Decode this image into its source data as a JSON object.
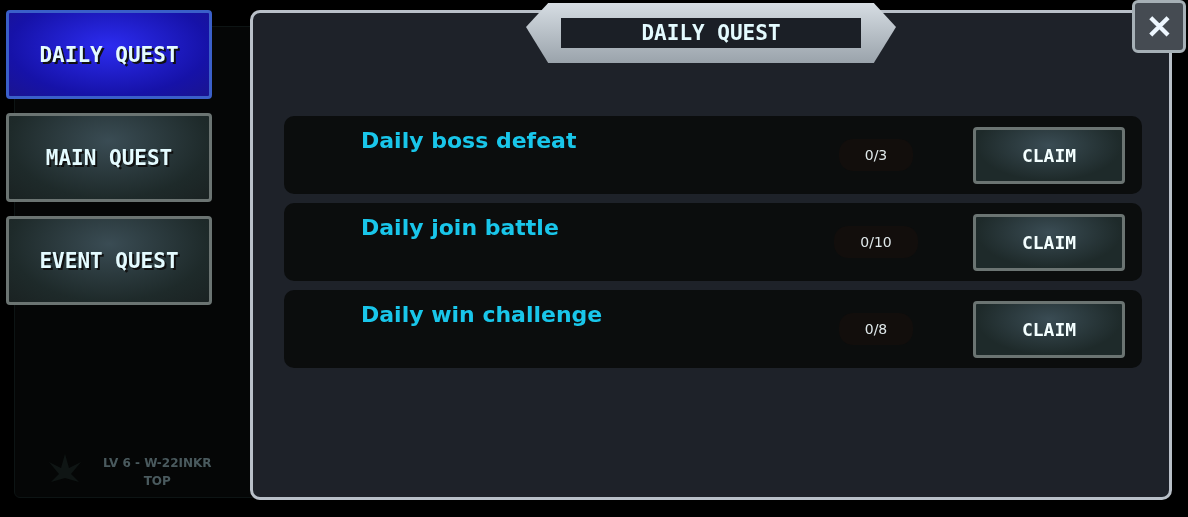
{
  "background": {
    "line_1": "LV 6 - W-22INKR",
    "line_2": "TOP"
  },
  "tabs": [
    {
      "label": "DAILY QUEST",
      "selected": true
    },
    {
      "label": "MAIN QUEST",
      "selected": false
    },
    {
      "label": "EVENT QUEST",
      "selected": false
    }
  ],
  "panel": {
    "title": "DAILY QUEST",
    "close": "✕"
  },
  "quests": [
    {
      "name": "Daily boss defeat",
      "progress": "0/3",
      "button": "CLAIM"
    },
    {
      "name": "Daily join battle",
      "progress": "0/10",
      "button": "CLAIM"
    },
    {
      "name": "Daily win challenge",
      "progress": "0/8",
      "button": "CLAIM"
    }
  ]
}
